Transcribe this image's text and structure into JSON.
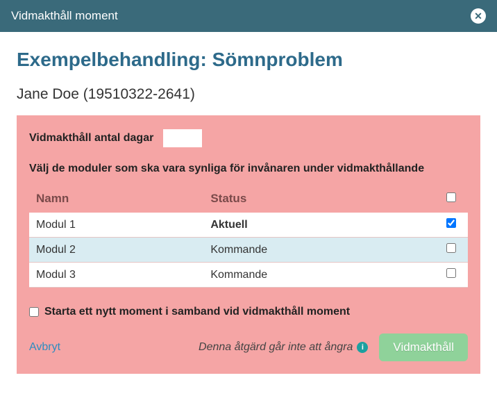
{
  "header": {
    "title": "Vidmakthåll moment"
  },
  "page": {
    "title": "Exempelbehandling: Sömnproblem",
    "patient": "Jane Doe (19510322-2641)"
  },
  "panel": {
    "days_label": "Vidmakthåll antal dagar",
    "days_value": "",
    "module_instruction": "Välj de moduler som ska vara synliga för invånaren under vidmakthållande",
    "columns": {
      "name": "Namn",
      "status": "Status"
    },
    "rows": [
      {
        "name": "Modul 1",
        "status": "Aktuell",
        "status_bold": true,
        "checked": true
      },
      {
        "name": "Modul 2",
        "status": "Kommande",
        "status_bold": false,
        "checked": false
      },
      {
        "name": "Modul 3",
        "status": "Kommande",
        "status_bold": false,
        "checked": false
      }
    ],
    "start_new_label": "Starta ett nytt moment i samband vid vidmakthåll moment",
    "start_new_checked": false
  },
  "footer": {
    "cancel": "Avbryt",
    "warning": "Denna åtgärd går inte att ångra",
    "submit": "Vidmakthåll"
  }
}
